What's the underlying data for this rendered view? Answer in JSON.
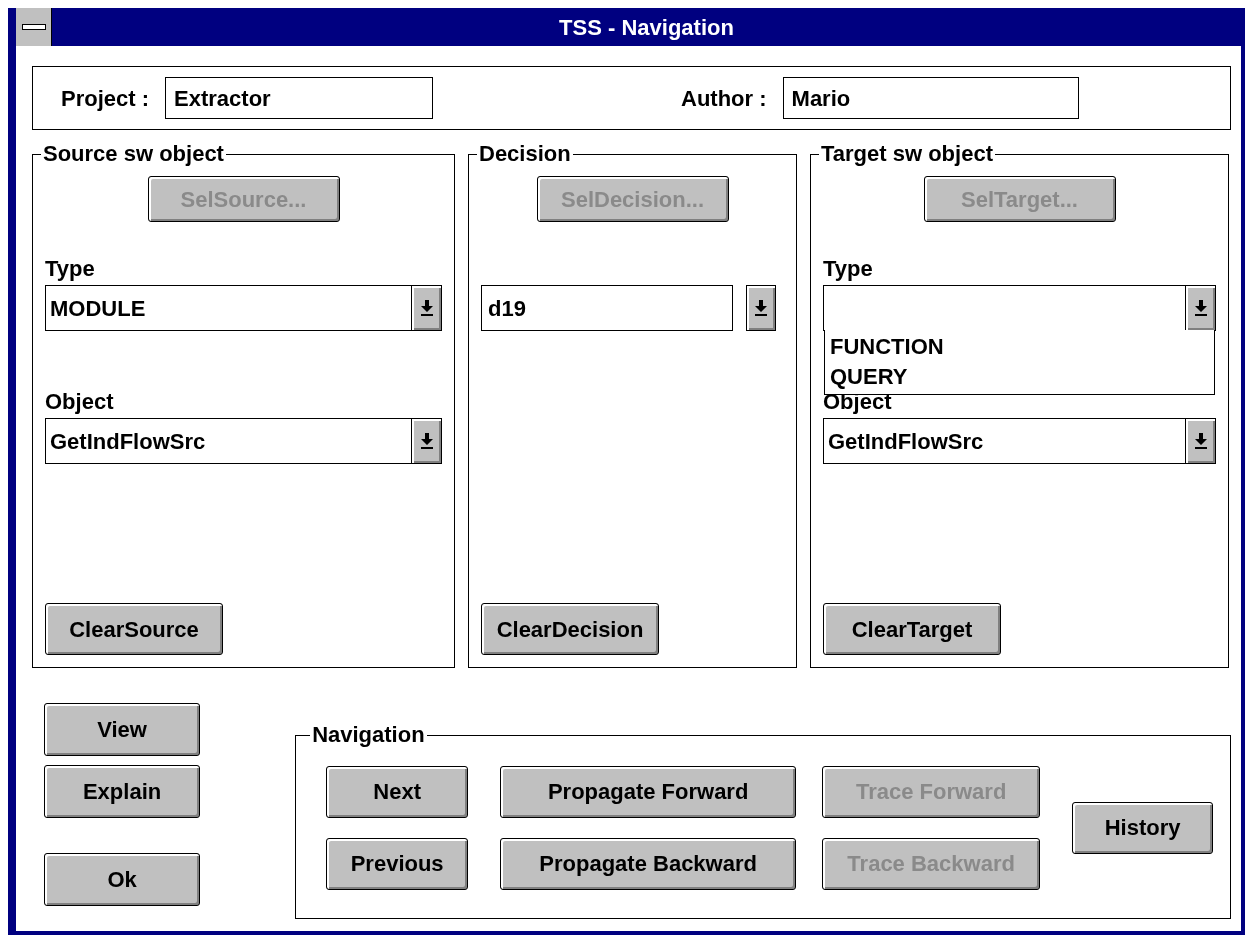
{
  "window": {
    "title": "TSS - Navigation"
  },
  "header": {
    "fields": [
      {
        "label": "Project :",
        "value": "Extractor"
      },
      {
        "label": "Author :",
        "value": "Mario"
      }
    ]
  },
  "groups": [
    {
      "title": "Source sw object",
      "select_button": {
        "label": "SelSource...",
        "disabled": true
      },
      "fields": [
        {
          "kind": "combo",
          "label": "Type",
          "value": "MODULE"
        },
        {
          "kind": "combo",
          "label": "Object",
          "value": "GetIndFlowSrc"
        }
      ],
      "clear_button": {
        "label": "ClearSource",
        "disabled": false
      }
    },
    {
      "title": "Decision",
      "select_button": {
        "label": "SelDecision...",
        "disabled": true
      },
      "fields": [
        {
          "kind": "split",
          "value": "d19"
        }
      ],
      "clear_button": {
        "label": "ClearDecision",
        "disabled": false
      }
    },
    {
      "title": "Target sw object",
      "select_button": {
        "label": "SelTarget...",
        "disabled": true
      },
      "fields": [
        {
          "kind": "combo",
          "label": "Type",
          "expanded": true,
          "options": [
            "FUNCTION",
            "QUERY"
          ]
        },
        {
          "kind": "combo",
          "label": "Object",
          "value": "GetIndFlowSrc"
        }
      ],
      "clear_button": {
        "label": "ClearTarget",
        "disabled": false
      }
    }
  ],
  "side_buttons": [
    {
      "label": "View",
      "disabled": false
    },
    {
      "label": "Explain",
      "disabled": false
    },
    {
      "label": "Ok",
      "disabled": false
    }
  ],
  "navigation": {
    "title": "Navigation",
    "columns": [
      [
        {
          "label": "Next",
          "disabled": false
        },
        {
          "label": "Previous",
          "disabled": false
        }
      ],
      [
        {
          "label": "Propagate Forward",
          "disabled": false
        },
        {
          "label": "Propagate Backward",
          "disabled": false
        }
      ],
      [
        {
          "label": "Trace Forward",
          "disabled": true
        },
        {
          "label": "Trace Backward",
          "disabled": true
        }
      ],
      [
        {
          "label": "History",
          "disabled": false
        }
      ]
    ]
  }
}
